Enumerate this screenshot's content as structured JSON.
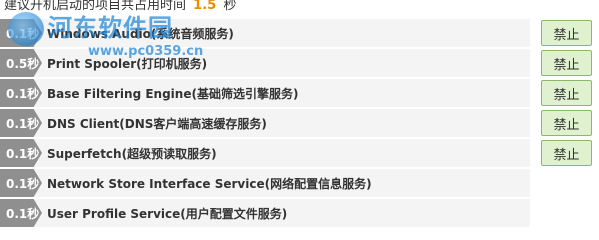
{
  "header": {
    "prefix": "建议开机启动的项目共占用时间",
    "total_time": "1.5",
    "unit": "秒"
  },
  "watermark": {
    "title": "河东软件园",
    "url": "www.pc0359.cn"
  },
  "rows": [
    {
      "time": "0.1秒",
      "name": "Windows Audio(系统音频服务)",
      "action": "禁止",
      "has_action": true
    },
    {
      "time": "0.5秒",
      "name": "Print Spooler(打印机服务)",
      "action": "禁止",
      "has_action": true
    },
    {
      "time": "0.1秒",
      "name": "Base Filtering Engine(基础筛选引擎服务)",
      "action": "禁止",
      "has_action": true
    },
    {
      "time": "0.1秒",
      "name": "DNS Client(DNS客户端高速缓存服务)",
      "action": "禁止",
      "has_action": true
    },
    {
      "time": "0.1秒",
      "name": "Superfetch(超级预读取服务)",
      "action": "禁止",
      "has_action": true
    },
    {
      "time": "0.1秒",
      "name": "Network Store Interface Service(网络配置信息服务)",
      "action": "",
      "has_action": false
    },
    {
      "time": "0.1秒",
      "name": "User Profile Service(用户配置文件服务)",
      "action": "",
      "has_action": false
    }
  ]
}
